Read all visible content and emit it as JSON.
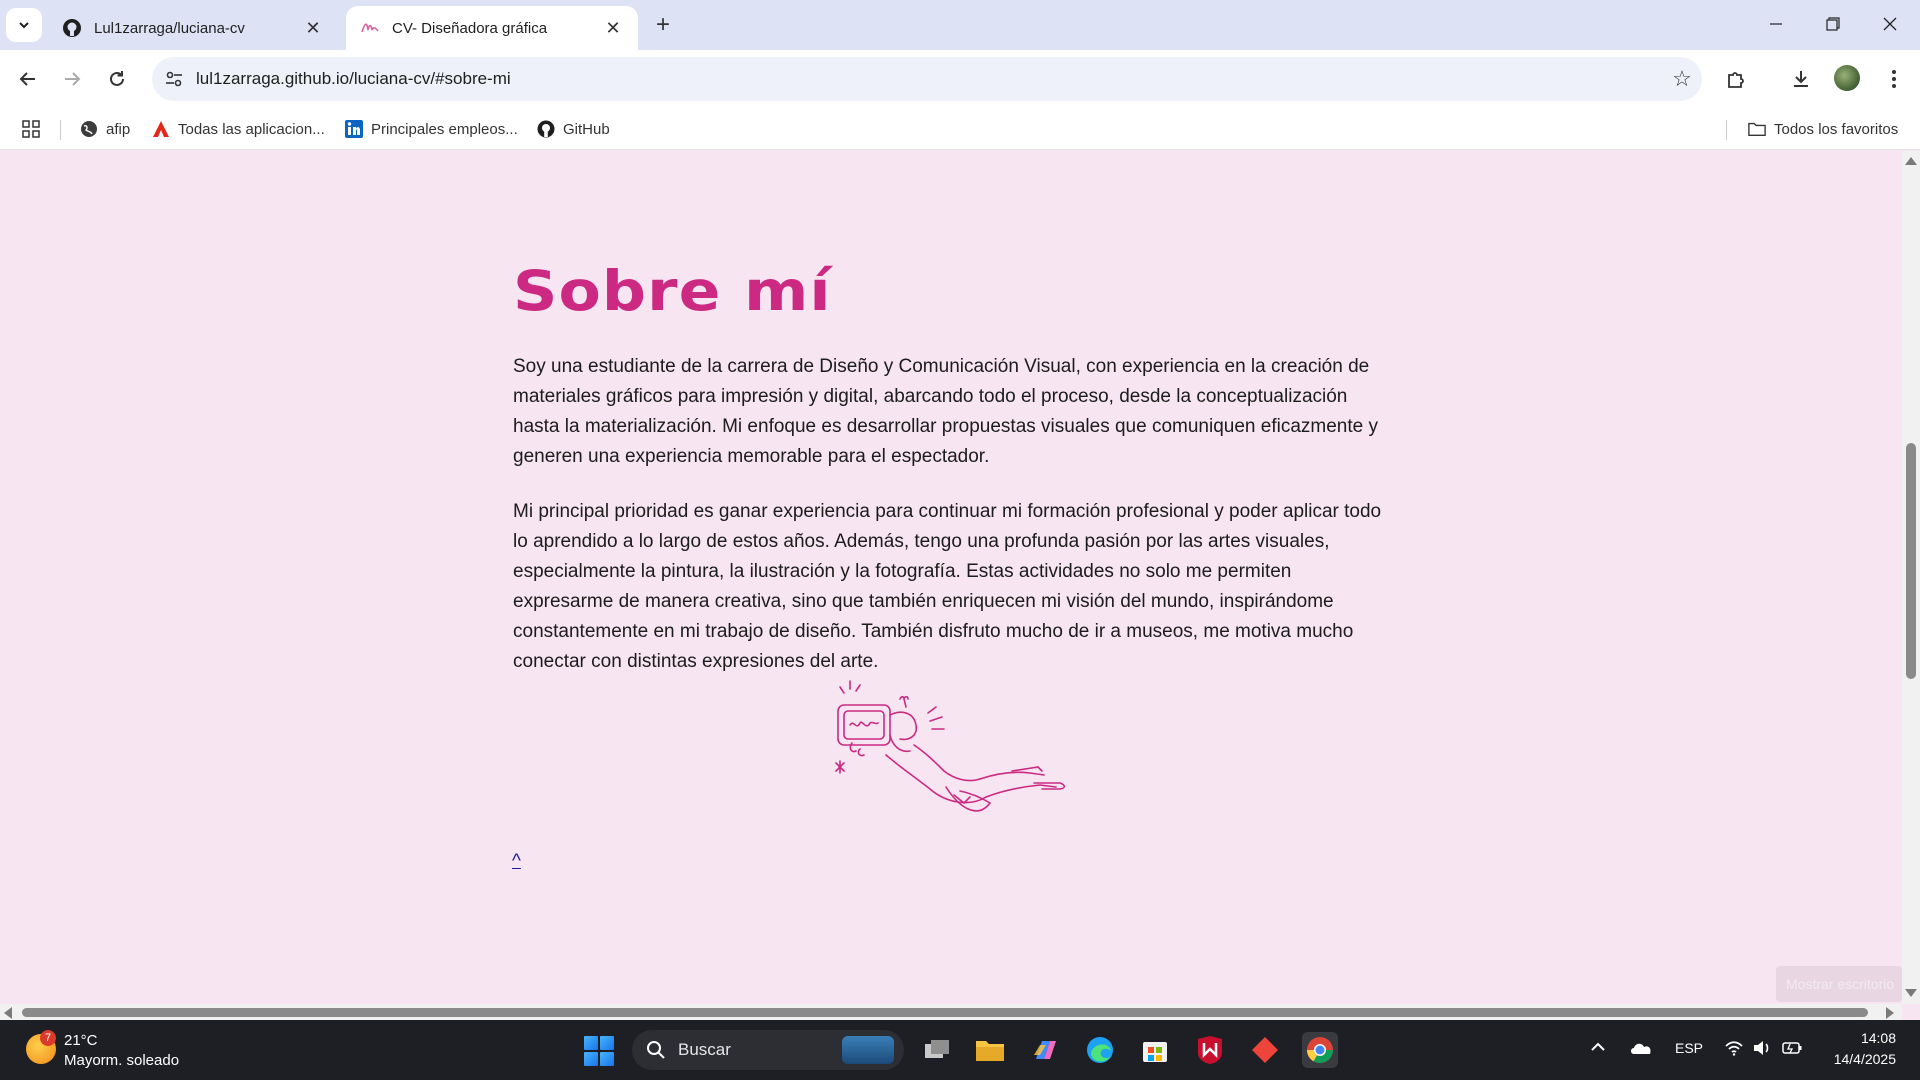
{
  "browser": {
    "tabs": [
      {
        "title": "Lul1zarraga/luciana-cv",
        "active": false,
        "favicon": "github-icon"
      },
      {
        "title": "CV- Diseñadora gráfica",
        "active": true,
        "favicon": "signature-icon"
      }
    ],
    "url": "lul1zarraga.github.io/luciana-cv/#sobre-mi",
    "bookmarks": [
      {
        "label": "afip",
        "icon": "globe-icon"
      },
      {
        "label": "Todas las aplicacion...",
        "icon": "adobe-icon"
      },
      {
        "label": "Principales empleos...",
        "icon": "linkedin-icon"
      },
      {
        "label": "GitHub",
        "icon": "github-icon"
      }
    ],
    "all_bookmarks_label": "Todos los favoritos"
  },
  "page": {
    "heading": "Sobre mí",
    "paragraphs": [
      "Soy una estudiante de la carrera de Diseño y Comunicación Visual, con experiencia en la creación de materiales gráficos para impresión y digital, abarcando todo el proceso, desde la conceptualización hasta la materialización. Mi enfoque es desarrollar propuestas visuales que comuniquen eficazmente y generen una experiencia memorable para el espectador.",
      "Mi principal prioridad es ganar experiencia para continuar mi formación profesional y poder aplicar todo lo aprendido a lo largo de estos años. Además, tengo una profunda pasión por las artes visuales, especialmente la pintura, la ilustración y la fotografía. Estas actividades no solo me permiten expresarme de manera creativa, sino que también enriquecen mi visión del mundo, inspirándome constantemente en mi trabajo de diseño. También disfruto mucho de ir a museos, me motiva mucho conectar con distintas expresiones del arte."
    ],
    "back_to_top": "^",
    "toast": "Mostrar escritorio",
    "accent_color": "#cc2a82"
  },
  "taskbar": {
    "weather_badge": "7",
    "temperature": "21°C",
    "condition": "Mayorm. soleado",
    "search_placeholder": "Buscar",
    "language": "ESP",
    "time": "14:08",
    "date": "14/4/2025"
  }
}
